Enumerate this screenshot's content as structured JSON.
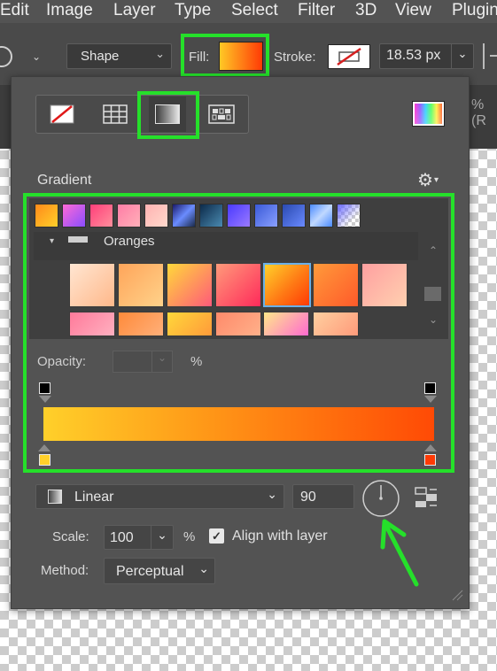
{
  "menu": [
    "Edit",
    "Image",
    "Layer",
    "Type",
    "Select",
    "Filter",
    "3D",
    "View",
    "Plugin"
  ],
  "options_bar": {
    "shape_mode": "Shape",
    "fill_label": "Fill:",
    "stroke_label": "Stroke:",
    "stroke_width": "18.53 px"
  },
  "doc_strip_text": "% (R",
  "panel": {
    "section_title": "Gradient",
    "preset_group": "Oranges",
    "opacity_label": "Opacity:",
    "opacity_unit": "%",
    "style_value": "Linear",
    "angle_value": "90",
    "scale_label": "Scale:",
    "scale_value": "100",
    "scale_unit": "%",
    "align_label": "Align with layer",
    "align_checked": true,
    "method_label": "Method:",
    "method_value": "Perceptual"
  },
  "colors": {
    "highlight": "#25e02a",
    "gradient_start": "#ffd02a",
    "gradient_end": "#ff4a05"
  },
  "icons": [
    "chevron-down-icon",
    "no-fill-icon",
    "solid-color-icon",
    "gradient-icon",
    "pattern-icon",
    "color-picker-icon",
    "gear-icon",
    "angle-dial-icon",
    "reverse-icon",
    "checkbox-icon",
    "resize-grip-icon"
  ]
}
